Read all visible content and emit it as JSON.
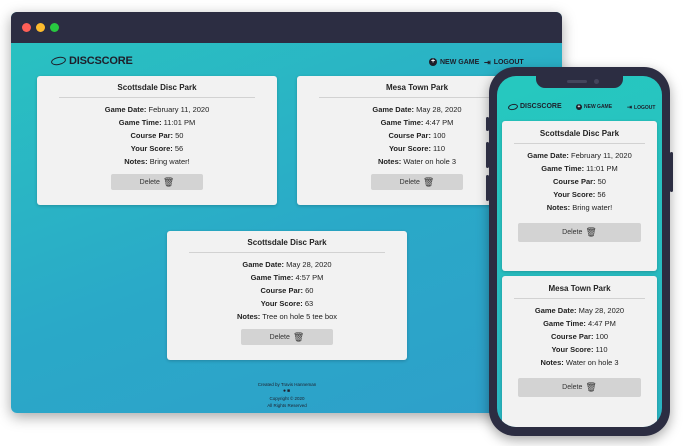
{
  "app": {
    "brand": "DISCSCORE"
  },
  "nav": {
    "new_game": "NEW GAME",
    "logout": "LOGOUT"
  },
  "labels": {
    "date": "Game Date:",
    "time": "Game Time:",
    "par": "Course Par:",
    "score": "Your Score:",
    "notes": "Notes:",
    "delete": "Delete"
  },
  "games": [
    {
      "course": "Scottsdale Disc Park",
      "date": "February 11, 2020",
      "time": "11:01 PM",
      "par": "50",
      "score": "56",
      "notes": "Bring water!"
    },
    {
      "course": "Mesa Town Park",
      "date": "May 28, 2020",
      "time": "4:47 PM",
      "par": "100",
      "score": "110",
      "notes": "Water on hole 3"
    },
    {
      "course": "Scottsdale Disc Park",
      "date": "May 28, 2020",
      "time": "4:57 PM",
      "par": "60",
      "score": "63",
      "notes": "Tree on hole 5 tee box"
    }
  ],
  "footer": {
    "created_by": "Created by Travis Hanneman",
    "copyright": "Copyright © 2020",
    "rights": "All Rights Reserved"
  },
  "icons": [
    "plus-circle-icon",
    "logout-icon",
    "trash-icon",
    "github-icon",
    "linkedin-icon",
    "disc-logo-icon"
  ],
  "colors": {
    "accent": "#2ab3c2",
    "dark": "#2c2d42",
    "card": "#f2f2f2",
    "button": "#d3d3d3"
  }
}
